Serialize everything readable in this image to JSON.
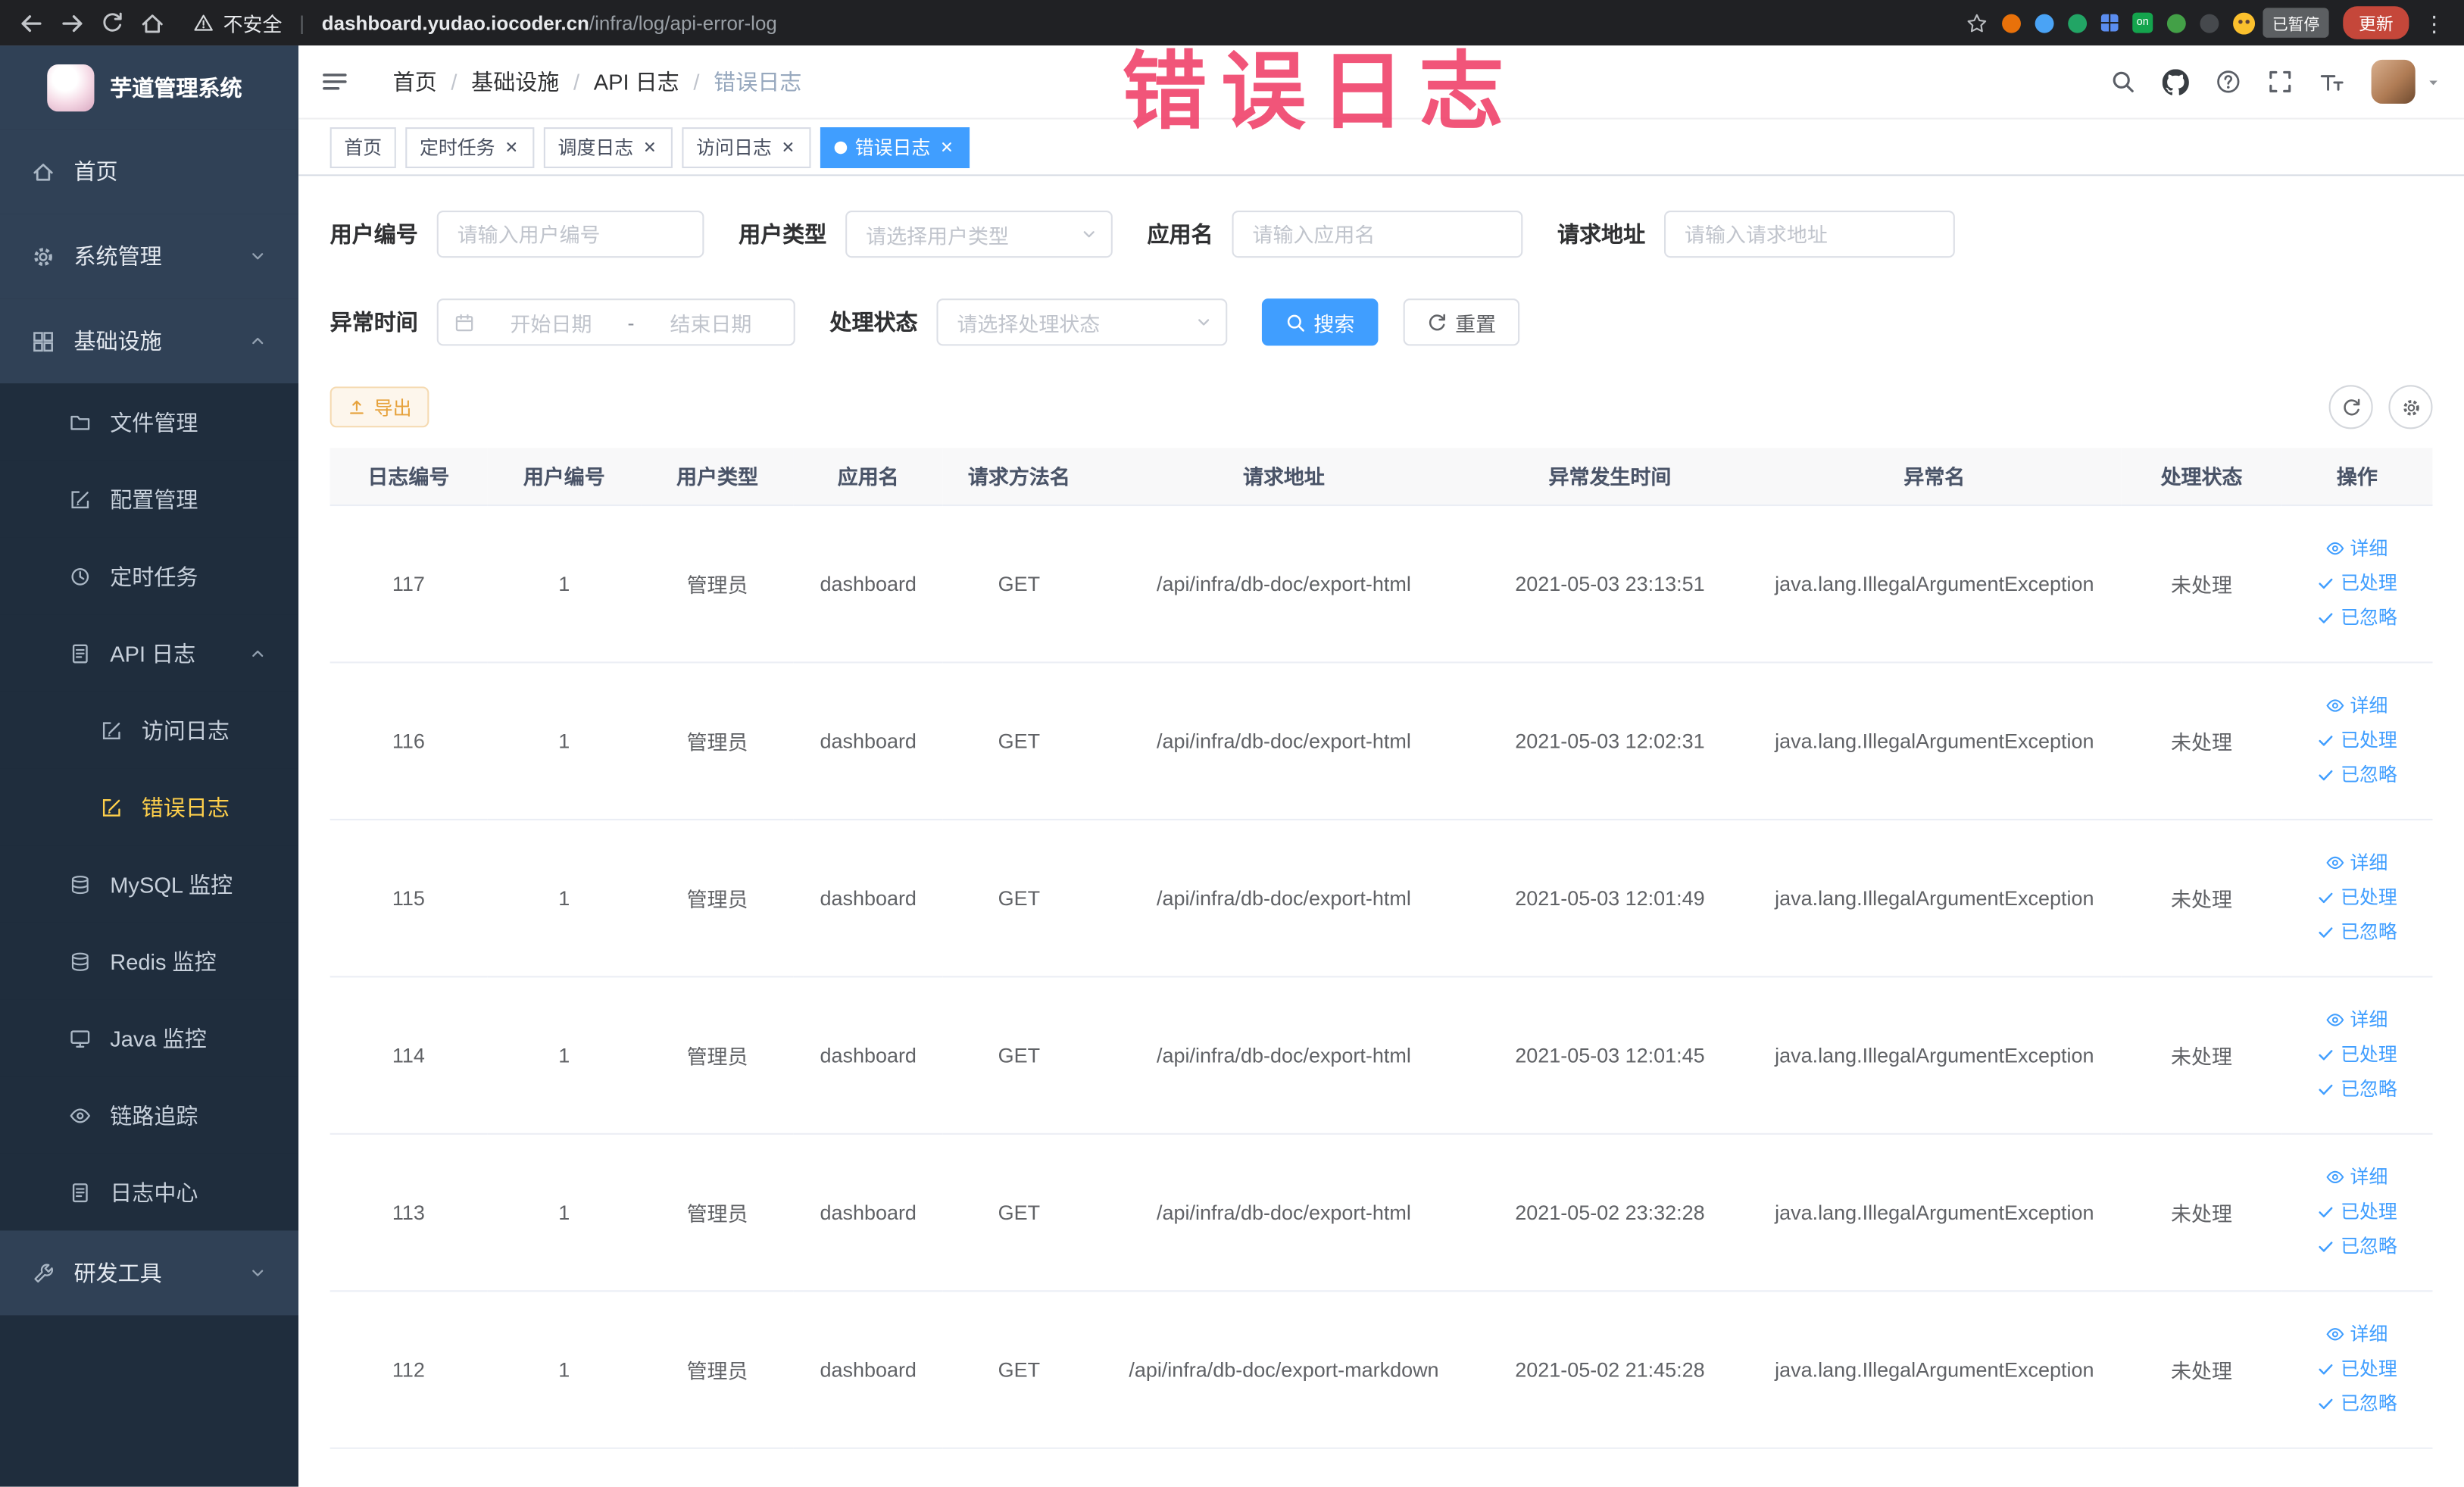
{
  "browser": {
    "security_label": "不安全",
    "url_host": "dashboard.yudao.iocoder.cn",
    "url_path": "/infra/log/api-error-log",
    "paused_badge": "已暂停",
    "update_button": "更新",
    "extension_on_badge": "on"
  },
  "annotation": {
    "text": "错误日志",
    "color": "#f0436b"
  },
  "sidebar": {
    "logo_title": "芋道管理系统",
    "active_item": "错误日志",
    "items": {
      "home": "首页",
      "system": "系统管理",
      "infra": "基础设施",
      "file": "文件管理",
      "config": "配置管理",
      "job": "定时任务",
      "api_log": "API 日志",
      "access_log": "访问日志",
      "error_log": "错误日志",
      "mysql": "MySQL 监控",
      "redis": "Redis 监控",
      "java": "Java 监控",
      "trace": "链路追踪",
      "log_center": "日志中心",
      "dev_tool": "研发工具"
    }
  },
  "header": {
    "breadcrumb": [
      "首页",
      "基础设施",
      "API 日志",
      "错误日志"
    ]
  },
  "tabs": [
    {
      "label": "首页",
      "closable": false,
      "active": false
    },
    {
      "label": "定时任务",
      "closable": true,
      "active": false
    },
    {
      "label": "调度日志",
      "closable": true,
      "active": false
    },
    {
      "label": "访问日志",
      "closable": true,
      "active": false
    },
    {
      "label": "错误日志",
      "closable": true,
      "active": true
    }
  ],
  "filters": {
    "user_id": {
      "label": "用户编号",
      "placeholder": "请输入用户编号"
    },
    "user_type": {
      "label": "用户类型",
      "placeholder": "请选择用户类型"
    },
    "app_name": {
      "label": "应用名",
      "placeholder": "请输入应用名"
    },
    "request_url": {
      "label": "请求地址",
      "placeholder": "请输入请求地址"
    },
    "exception_time": {
      "label": "异常时间",
      "start_placeholder": "开始日期",
      "end_placeholder": "结束日期",
      "separator": "-"
    },
    "process_status": {
      "label": "处理状态",
      "placeholder": "请选择处理状态"
    },
    "search_button": "搜索",
    "reset_button": "重置"
  },
  "toolbar": {
    "export_button": "导出"
  },
  "table": {
    "columns": [
      "日志编号",
      "用户编号",
      "用户类型",
      "应用名",
      "请求方法名",
      "请求地址",
      "异常发生时间",
      "异常名",
      "处理状态",
      "操作"
    ],
    "actions": [
      "详细",
      "已处理",
      "已忽略"
    ],
    "rows": [
      {
        "id": "117",
        "user_id": "1",
        "user_type": "管理员",
        "app": "dashboard",
        "method": "GET",
        "url": "/api/infra/db-doc/export-html",
        "time": "2021-05-03 23:13:51",
        "exception": "java.lang.IllegalArgumentException",
        "status": "未处理"
      },
      {
        "id": "116",
        "user_id": "1",
        "user_type": "管理员",
        "app": "dashboard",
        "method": "GET",
        "url": "/api/infra/db-doc/export-html",
        "time": "2021-05-03 12:02:31",
        "exception": "java.lang.IllegalArgumentException",
        "status": "未处理"
      },
      {
        "id": "115",
        "user_id": "1",
        "user_type": "管理员",
        "app": "dashboard",
        "method": "GET",
        "url": "/api/infra/db-doc/export-html",
        "time": "2021-05-03 12:01:49",
        "exception": "java.lang.IllegalArgumentException",
        "status": "未处理"
      },
      {
        "id": "114",
        "user_id": "1",
        "user_type": "管理员",
        "app": "dashboard",
        "method": "GET",
        "url": "/api/infra/db-doc/export-html",
        "time": "2021-05-03 12:01:45",
        "exception": "java.lang.IllegalArgumentException",
        "status": "未处理"
      },
      {
        "id": "113",
        "user_id": "1",
        "user_type": "管理员",
        "app": "dashboard",
        "method": "GET",
        "url": "/api/infra/db-doc/export-html",
        "time": "2021-05-02 23:32:28",
        "exception": "java.lang.IllegalArgumentException",
        "status": "未处理"
      },
      {
        "id": "112",
        "user_id": "1",
        "user_type": "管理员",
        "app": "dashboard",
        "method": "GET",
        "url": "/api/infra/db-doc/export-markdown",
        "time": "2021-05-02 21:45:28",
        "exception": "java.lang.IllegalArgumentException",
        "status": "未处理"
      }
    ]
  },
  "colors": {
    "primary": "#409eff",
    "sidebar_bg": "#304156",
    "sidebar_submenu_bg": "#1f2d3d",
    "sidebar_active_text": "#ffd04b",
    "tab_active_bg": "#409eff",
    "warning_button_text": "#e6a23c",
    "annotation": "#f0436b"
  }
}
